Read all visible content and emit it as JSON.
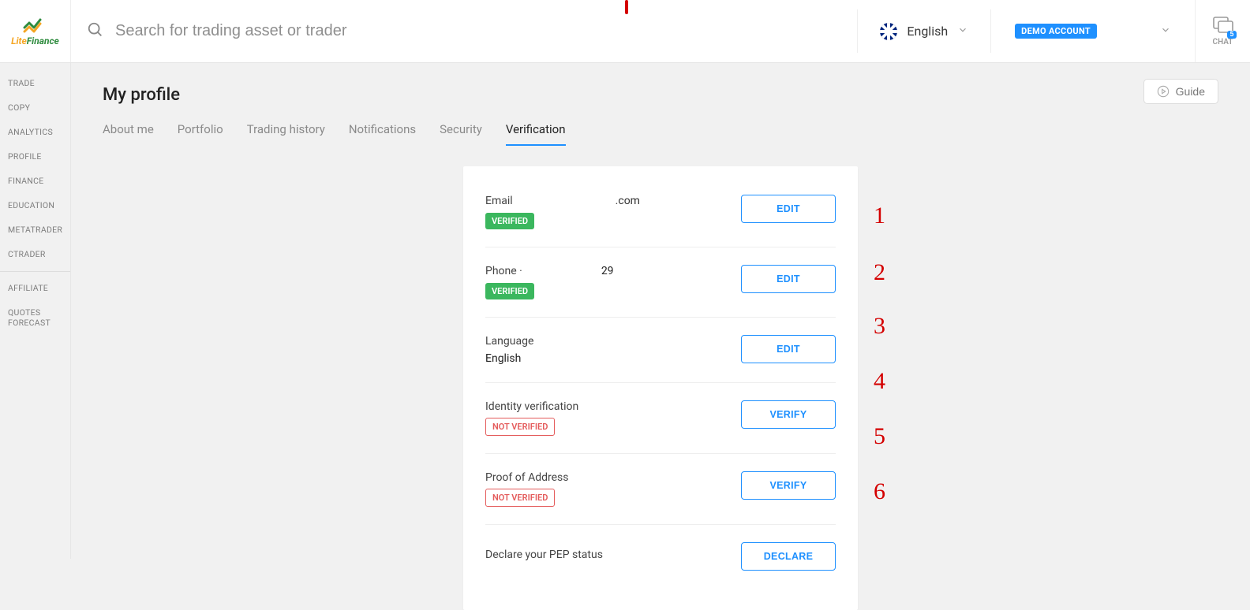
{
  "logo": {
    "brand1": "Lite",
    "brand2": "Finance"
  },
  "search": {
    "placeholder": "Search for trading asset or trader"
  },
  "language": {
    "label": "English"
  },
  "account": {
    "badge": "DEMO ACCOUNT"
  },
  "chat": {
    "label": "CHAT",
    "count": "5"
  },
  "sidebar": {
    "items": [
      "TRADE",
      "COPY",
      "ANALYTICS",
      "PROFILE",
      "FINANCE",
      "EDUCATION",
      "METATRADER",
      "CTRADER",
      "AFFILIATE",
      "QUOTES FORECAST"
    ]
  },
  "page": {
    "title": "My profile",
    "guide": "Guide"
  },
  "tabs": [
    "About me",
    "Portfolio",
    "Trading history",
    "Notifications",
    "Security",
    "Verification"
  ],
  "active_tab_index": 5,
  "verification": {
    "rows": [
      {
        "label": "Email",
        "detail": ".com",
        "status": "VERIFIED",
        "status_type": "verified",
        "action": "EDIT"
      },
      {
        "label": "Phone ·",
        "detail": "29",
        "status": "VERIFIED",
        "status_type": "verified",
        "action": "EDIT"
      },
      {
        "label": "Language",
        "value": "English",
        "action": "EDIT"
      },
      {
        "label": "Identity verification",
        "status": "NOT VERIFIED",
        "status_type": "notverified",
        "action": "VERIFY"
      },
      {
        "label": "Proof of Address",
        "status": "NOT VERIFIED",
        "status_type": "notverified",
        "action": "VERIFY"
      },
      {
        "label": "Declare your PEP status",
        "action": "DECLARE"
      }
    ]
  },
  "annotations": [
    "1",
    "2",
    "3",
    "4",
    "5",
    "6"
  ]
}
